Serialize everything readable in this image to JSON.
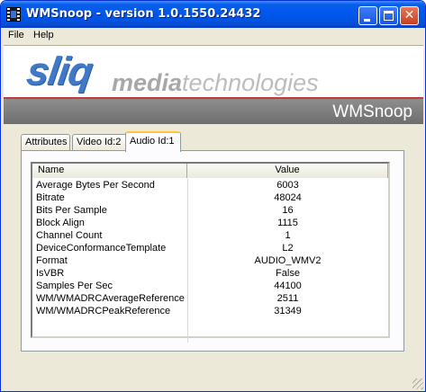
{
  "window": {
    "title": "WMSnoop - version 1.0.1550.24432",
    "minimize_icon": "minimize-icon",
    "maximize_icon": "maximize-icon",
    "close_icon": "close-icon",
    "close_glyph": "✕"
  },
  "menu": {
    "file": "File",
    "help": "Help"
  },
  "banner": {
    "logo_sliq": "sliq",
    "logo_media": "media",
    "logo_technologies": "technologies",
    "logo_color": "#3f79c7",
    "product_name": "WMSnoop",
    "bar_color": "#7a7a7a",
    "accent_line_color": "#c23a3a"
  },
  "tabs": [
    {
      "label": "Attributes",
      "selected": false
    },
    {
      "label": "Video Id:2",
      "selected": false
    },
    {
      "label": "Audio Id:1",
      "selected": true
    }
  ],
  "list": {
    "columns": {
      "name": "Name",
      "value": "Value"
    },
    "rows": [
      {
        "name": "Average Bytes Per Second",
        "value": "6003"
      },
      {
        "name": "Bitrate",
        "value": "48024"
      },
      {
        "name": "Bits Per Sample",
        "value": "16"
      },
      {
        "name": "Block Align",
        "value": "1115"
      },
      {
        "name": "Channel Count",
        "value": "1"
      },
      {
        "name": "DeviceConformanceTemplate",
        "value": "L2"
      },
      {
        "name": "Format",
        "value": "AUDIO_WMV2"
      },
      {
        "name": "IsVBR",
        "value": "False"
      },
      {
        "name": "Samples Per Sec",
        "value": "44100"
      },
      {
        "name": "WM/WMADRCAverageReference",
        "value": "2511"
      },
      {
        "name": "WM/WMADRCPeakReference",
        "value": "31349"
      }
    ]
  }
}
